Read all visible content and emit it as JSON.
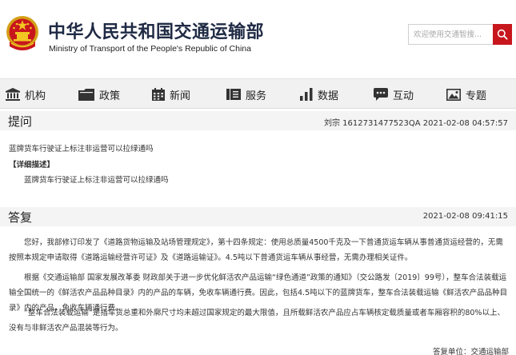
{
  "header": {
    "title_cn": "中华人民共和国交通运输部",
    "title_en": "Ministry of Transport of the People's Republic of China",
    "search_placeholder": "欢迎使用交通智搜...",
    "emblem_icon": "national-emblem-icon",
    "search_icon": "search-icon",
    "accent_color": "#c8161d"
  },
  "nav": {
    "items": [
      {
        "label": "机构",
        "icon": "institution-icon"
      },
      {
        "label": "政策",
        "icon": "folder-icon"
      },
      {
        "label": "新闻",
        "icon": "calendar-icon"
      },
      {
        "label": "服务",
        "icon": "service-icon"
      },
      {
        "label": "数据",
        "icon": "bar-chart-icon"
      },
      {
        "label": "互动",
        "icon": "chat-icon"
      },
      {
        "label": "专题",
        "icon": "image-icon"
      }
    ]
  },
  "question": {
    "title": "提问",
    "meta": "刘宗 1612731477523QA   2021-02-08 04:57:57",
    "summary": "蓝牌货车行驶证上标注非运营可以拉绿通吗",
    "detail_label": "【详细描述】",
    "detail": "蓝牌货车行驶证上标注非运营可以拉绿通吗"
  },
  "answer": {
    "title": "答复",
    "date": "2021-02-08 09:41:15",
    "paragraphs": [
      "您好，我部修订印发了《道路货物运输及站场管理规定》，第十四条规定：使用总质量4500千克及一下普通货运车辆从事普通货运经营的，无需按照本规定申请取得《道路运输经营许可证》及《道路运输证》。4.5吨以下普通货运车辆从事经营，无需办理相关证件。",
      "根据《交通运输部 国家发展改革委 财政部关于进一步优化鲜活农产品运输“绿色通道”政策的通知》（交公路发〔2019〕99号），整车合法装载运输全国统一的《鲜活农产品品种目录》内的产品的车辆，免收车辆通行费。因此，包括4.5吨以下的蓝牌货车，整车合法装载运输《鲜活农产品品种目录》内的产品，免收车辆通行费。",
      "“整车合法装载运输”是指车货总重和外廓尺寸均未超过国家规定的最大限值，且所载鲜活农产品应占车辆核定载质量或者车厢容积的80%以上、没有与非鲜活农产品混装等行为。"
    ],
    "signature": "答复单位：交通运输部"
  }
}
